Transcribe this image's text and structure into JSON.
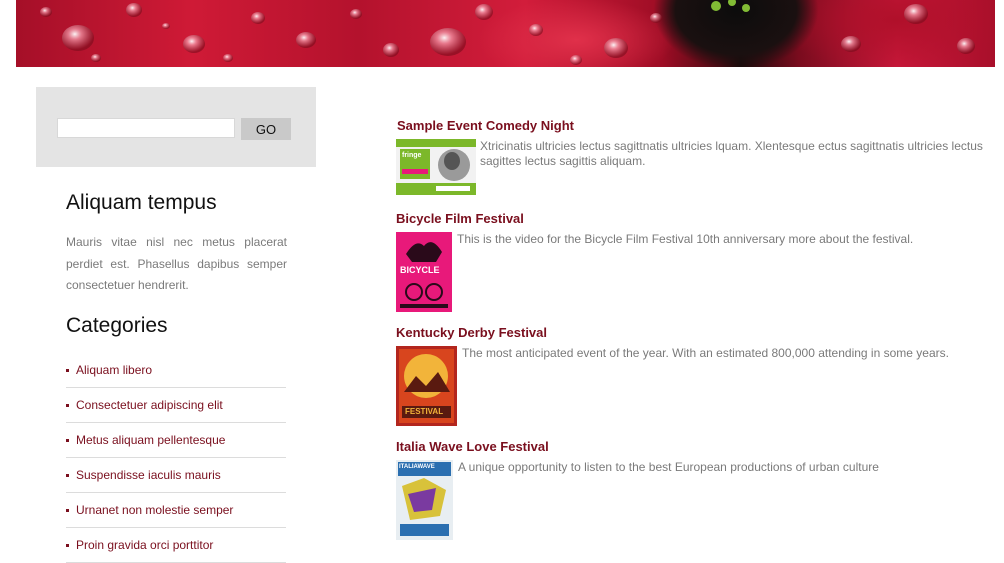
{
  "header": {
    "banner_image": "red-petals-water-droplets"
  },
  "search": {
    "value": "",
    "placeholder": "",
    "button_label": "GO"
  },
  "about": {
    "title": "Aliquam tempus",
    "text": "Mauris vitae nisl nec metus placerat perdiet est. Phasellus dapibus semper consectetuer hendrerit."
  },
  "categories": {
    "title": "Categories",
    "items": [
      {
        "label": "Aliquam libero"
      },
      {
        "label": "Consectetuer adipiscing elit"
      },
      {
        "label": "Metus aliquam pellentesque"
      },
      {
        "label": "Suspendisse iaculis mauris"
      },
      {
        "label": "Urnanet non molestie semper"
      },
      {
        "label": "Proin gravida orci porttitor"
      }
    ]
  },
  "events": [
    {
      "title": "Sample Event Comedy Night",
      "description": "Xtricinatis ultricies lectus sagittnatis ultricies lquam. Xlentesque ectus sagittnatis ultricies lectus sagittes lectus sagittis aliquam.",
      "thumb_text": "fringe",
      "thumb_colors": [
        "#7cb82a",
        "#f2f2f2",
        "#555555"
      ]
    },
    {
      "title": "Bicycle Film Festival",
      "description": "This is the video for the Bicycle Film Festival 10th anniversary more about the festival.",
      "thumb_text": "BICYCLE",
      "thumb_colors": [
        "#e8197a",
        "#ffffff",
        "#2a0a1a"
      ]
    },
    {
      "title": "Kentucky Derby Festival",
      "description": "The most anticipated event of the year. With an estimated 800,000 attending in some years.",
      "thumb_text": "FESTIVAL",
      "thumb_colors": [
        "#b3261e",
        "#f2b43a",
        "#5a1a10"
      ]
    },
    {
      "title": "Italia Wave Love Festival",
      "description": "A unique opportunity to listen to the best European productions of urban culture",
      "thumb_text": "ITALIAWAVE",
      "thumb_colors": [
        "#e8eef2",
        "#2b6fb0",
        "#d8c23a"
      ]
    }
  ],
  "colors": {
    "accent": "#7a0f1e",
    "text_muted": "#7a7a7a",
    "search_bg": "#e4e4e4"
  }
}
